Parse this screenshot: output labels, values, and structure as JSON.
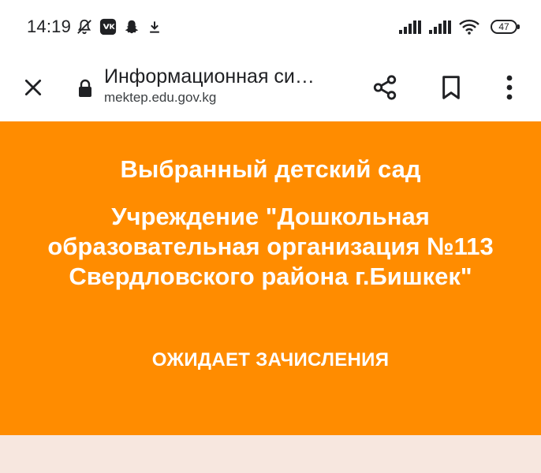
{
  "status_bar": {
    "time": "14:19",
    "battery": "47",
    "left_icons": [
      "muted-notifications-icon",
      "vk-icon",
      "snapchat-icon",
      "download-icon"
    ],
    "right_icons": [
      "signal-icon",
      "signal-icon",
      "wifi-icon"
    ]
  },
  "toolbar": {
    "page_title": "Информационная си…",
    "domain": "mektep.edu.gov.kg",
    "icons": [
      "close-icon",
      "lock-icon",
      "share-icon",
      "bookmark-icon",
      "more-vert-icon"
    ]
  },
  "hero": {
    "heading": "Выбранный детский сад",
    "name_lines": [
      "Учреждение \"Дошкольная",
      "образовательная организация №113",
      "Свердловского района г.Бишкек\""
    ],
    "status": "ОЖИДАЕТ ЗАЧИСЛЕНИЯ"
  },
  "colors": {
    "hero_background": "#ff8c00",
    "lower_background": "#f7e7df",
    "text_dark": "#202124"
  }
}
